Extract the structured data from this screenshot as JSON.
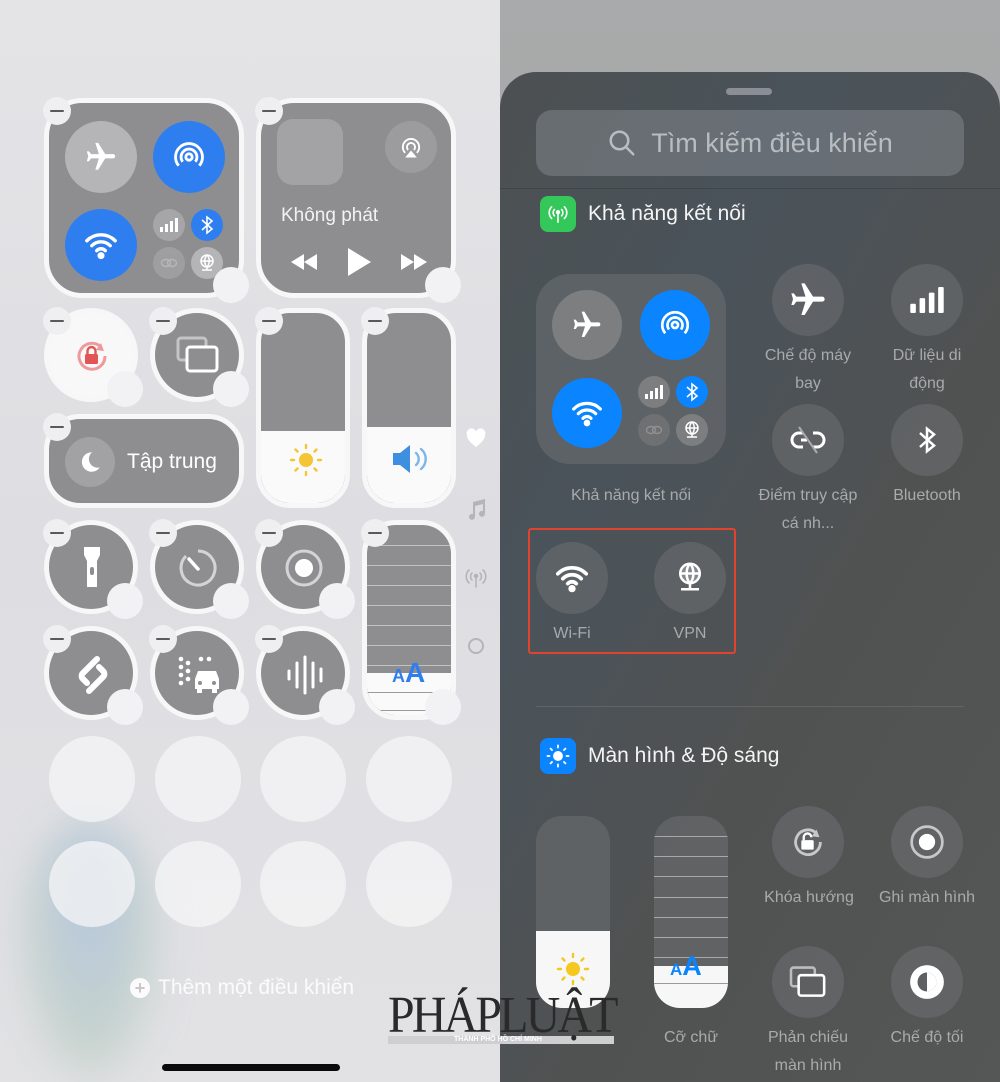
{
  "left": {
    "media_tile": {
      "status": "Không phát"
    },
    "focus_tile": {
      "label": "Tập trung"
    },
    "add_control": {
      "label": "Thêm một điều khiển"
    },
    "side_page_icons": [
      "heart-icon",
      "music-note-icon",
      "antenna-icon",
      "circle-icon"
    ],
    "brightness_level": 0.38,
    "volume_level": 0.4,
    "text_size_level": 0.22,
    "placeholder_rows": 2,
    "placeholder_cols": 4
  },
  "right": {
    "search": {
      "placeholder": "Tìm kiếm điều khiển"
    },
    "sections": [
      {
        "title": "Khả năng kết nối",
        "icon": "antenna-icon",
        "icon_color": "#34c759",
        "group_label": "Khả năng kết nối",
        "controls": [
          {
            "label": "Chế độ máy bay",
            "icon": "airplane-icon"
          },
          {
            "label": "Dữ liệu di động",
            "icon": "cellular-icon"
          },
          {
            "label": "Điểm truy cập cá nh...",
            "icon": "hotspot-icon"
          },
          {
            "label": "Bluetooth",
            "icon": "bluetooth-icon"
          },
          {
            "label": "Wi-Fi",
            "icon": "wifi-icon"
          },
          {
            "label": "VPN",
            "icon": "vpn-icon"
          }
        ]
      },
      {
        "title": "Màn hình & Độ sáng",
        "icon": "sun-icon",
        "icon_color": "#0a84ff",
        "controls": [
          {
            "label": "",
            "icon": "brightness-slider"
          },
          {
            "label": "Cỡ chữ",
            "icon": "text-size-slider"
          },
          {
            "label": "Khóa hướng",
            "icon": "orientation-lock-icon"
          },
          {
            "label": "Ghi màn hình",
            "icon": "screen-record-icon"
          },
          {
            "label": "Phản chiếu màn hình",
            "icon": "screen-mirror-icon"
          },
          {
            "label": "Chế độ tối",
            "icon": "dark-mode-icon"
          }
        ]
      }
    ],
    "highlight_color": "#e0442e",
    "brightness_level": 0.4,
    "text_size_level": 0.22
  },
  "watermark": {
    "text": "PHÁPLUẬT",
    "sub": "THÀNH PHỐ HỒ CHÍ MINH"
  },
  "accent_blue": "#2f7ef0"
}
